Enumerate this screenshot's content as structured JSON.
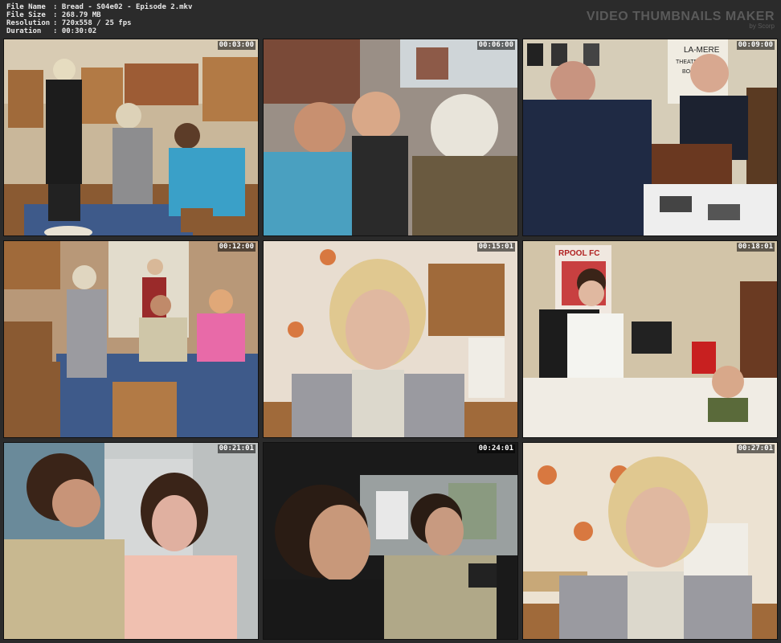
{
  "header": {
    "file_name_label": "File Name",
    "file_name": ": Bread - S04e02 - Episode 2.mkv",
    "file_size_label": "File Size",
    "file_size": ": 268.79 MB",
    "resolution_label": "Resolution",
    "resolution": ": 720x558 / 25 fps",
    "duration_label": "Duration",
    "duration": ": 00:30:02",
    "brand_title": "VIDEO THUMBNAILS MAKER",
    "brand_sub": "by Scorp"
  },
  "thumbnails": [
    {
      "timestamp": "00:03:00",
      "scene_icon": "kitchen-scene-icon"
    },
    {
      "timestamp": "00:06:00",
      "scene_icon": "street-scene-icon"
    },
    {
      "timestamp": "00:09:00",
      "scene_icon": "office-scene-icon"
    },
    {
      "timestamp": "00:12:00",
      "scene_icon": "dining-scene-icon"
    },
    {
      "timestamp": "00:15:01",
      "scene_icon": "portrait-scene-icon"
    },
    {
      "timestamp": "00:18:01",
      "scene_icon": "bedroom-scene-icon"
    },
    {
      "timestamp": "00:21:01",
      "scene_icon": "kitchen-talk-scene-icon"
    },
    {
      "timestamp": "00:24:01",
      "scene_icon": "car-scene-icon"
    },
    {
      "timestamp": "00:27:01",
      "scene_icon": "portrait-scene-icon"
    }
  ],
  "overlay_texts": {
    "poster_1": "LA-MERE",
    "poster_2": "THEATRICAL",
    "poster_3": "BOOKING",
    "banner": "RPOOL FC"
  }
}
